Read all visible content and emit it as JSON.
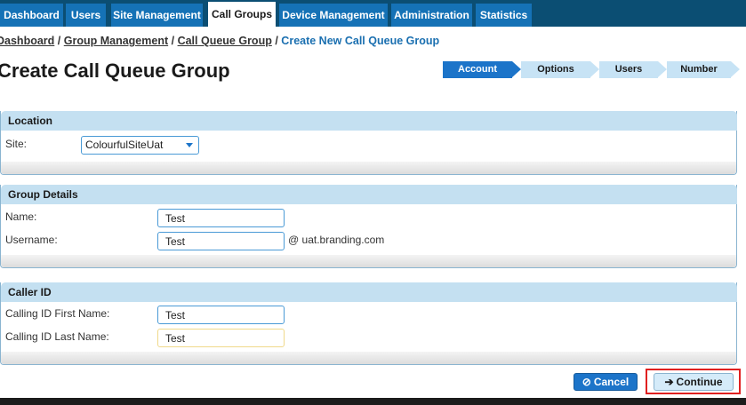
{
  "nav": {
    "tabs": [
      {
        "label": "Dashboard"
      },
      {
        "label": "Users"
      },
      {
        "label": "Site Management"
      },
      {
        "label": "Call Groups",
        "active": true
      },
      {
        "label": "Device Management"
      },
      {
        "label": "Administration"
      },
      {
        "label": "Statistics"
      }
    ]
  },
  "breadcrumb": {
    "items": [
      "Dashboard",
      "Group Management",
      "Call Queue Group"
    ],
    "separator": "/",
    "current": "Create New Call Queue Group"
  },
  "page": {
    "title": "Create Call Queue Group"
  },
  "wizard": {
    "steps": [
      "Account",
      "Options",
      "Users",
      "Number"
    ],
    "active_index": 0
  },
  "location": {
    "header": "Location",
    "site_label": "Site:",
    "site_value": "ColourfulSiteUat"
  },
  "group_details": {
    "header": "Group Details",
    "name_label": "Name:",
    "name_value": "Test",
    "username_label": "Username:",
    "username_value": "Test",
    "username_suffix": "@ uat.branding.com"
  },
  "caller_id": {
    "header": "Caller ID",
    "first_name_label": "Calling ID First Name:",
    "first_name_value": "Test",
    "last_name_label": "Calling ID Last Name:",
    "last_name_value": "Test"
  },
  "actions": {
    "cancel_label": "Cancel",
    "continue_label": "Continue",
    "cancel_icon": "ban-icon",
    "continue_icon": "arrow-right-icon"
  },
  "colors": {
    "nav_bg": "#0b4e73",
    "tab_bg": "#1572b6",
    "accent": "#1c74c9",
    "panel_header": "#c4e0f1",
    "highlight": "#e02020"
  }
}
